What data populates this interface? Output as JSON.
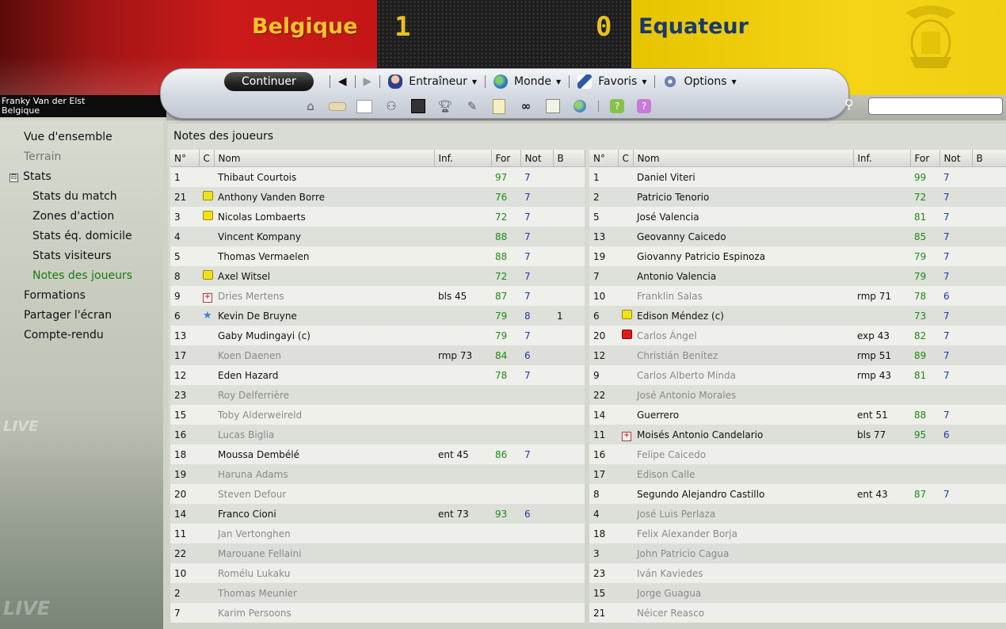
{
  "match": {
    "home_team": "Belgique",
    "away_team": "Equateur",
    "home_score": "1",
    "away_score": "0",
    "home_color": "#c41616",
    "away_color": "#f0cf12",
    "score_color": "#e8c21e"
  },
  "user": {
    "name": "Franky Van der Elst",
    "country": "Belgique"
  },
  "toolbar": {
    "continue_label": "Continuer",
    "menus": [
      {
        "label": "Entraîneur",
        "icon": "manager-icon"
      },
      {
        "label": "Monde",
        "icon": "globe-icon"
      },
      {
        "label": "Favoris",
        "icon": "pen-icon"
      },
      {
        "label": "Options",
        "icon": "gears-icon"
      }
    ],
    "quick_icons": [
      "home-icon",
      "inbox-icon",
      "calendar-icon",
      "squad-icon",
      "tactics-icon",
      "trophy-icon",
      "scout-icon",
      "notes-icon",
      "binoculars-icon",
      "document-icon",
      "world-icon",
      "help-icon",
      "question-icon"
    ]
  },
  "sidebar": {
    "items": [
      {
        "label": "Vue d'ensemble",
        "state": "normal"
      },
      {
        "label": "Terrain",
        "state": "disabled"
      },
      {
        "label": "Stats",
        "state": "expanded"
      },
      {
        "label": "Stats du match",
        "state": "child"
      },
      {
        "label": "Zones d'action",
        "state": "child"
      },
      {
        "label": "Stats éq. domicile",
        "state": "child"
      },
      {
        "label": "Stats visiteurs",
        "state": "child"
      },
      {
        "label": "Notes des joueurs",
        "state": "active"
      },
      {
        "label": "Formations",
        "state": "normal"
      },
      {
        "label": "Partager l'écran",
        "state": "normal"
      },
      {
        "label": "Compte-rendu",
        "state": "normal"
      }
    ],
    "tree_toggle": "⊟"
  },
  "content": {
    "title": "Notes des joueurs",
    "columns": [
      "N°",
      "C",
      "Nom",
      "Inf.",
      "For",
      "Not",
      "B"
    ],
    "home_players": [
      {
        "num": "1",
        "mark": "",
        "name": "Thibaut Courtois",
        "inf": "",
        "for": "97",
        "not": "7",
        "b": "",
        "subbed": false
      },
      {
        "num": "21",
        "mark": "yellow",
        "name": "Anthony Vanden Borre",
        "inf": "",
        "for": "76",
        "not": "7",
        "b": "",
        "subbed": false
      },
      {
        "num": "3",
        "mark": "yellow",
        "name": "Nicolas Lombaerts",
        "inf": "",
        "for": "72",
        "not": "7",
        "b": "",
        "subbed": false
      },
      {
        "num": "4",
        "mark": "",
        "name": "Vincent Kompany",
        "inf": "",
        "for": "88",
        "not": "7",
        "b": "",
        "subbed": false
      },
      {
        "num": "5",
        "mark": "",
        "name": "Thomas Vermaelen",
        "inf": "",
        "for": "88",
        "not": "7",
        "b": "",
        "subbed": false
      },
      {
        "num": "8",
        "mark": "yellow",
        "name": "Axel Witsel",
        "inf": "",
        "for": "72",
        "not": "7",
        "b": "",
        "subbed": false
      },
      {
        "num": "9",
        "mark": "injury",
        "name": "Dries Mertens",
        "inf": "bls 45",
        "for": "87",
        "not": "7",
        "b": "",
        "subbed": true
      },
      {
        "num": "6",
        "mark": "star",
        "name": "Kevin De Bruyne",
        "inf": "",
        "for": "79",
        "not": "8",
        "b": "1",
        "subbed": false
      },
      {
        "num": "13",
        "mark": "",
        "name": "Gaby Mudingayi (c)",
        "inf": "",
        "for": "79",
        "not": "7",
        "b": "",
        "subbed": false
      },
      {
        "num": "17",
        "mark": "",
        "name": "Koen Daenen",
        "inf": "rmp 73",
        "for": "84",
        "not": "6",
        "b": "",
        "subbed": true
      },
      {
        "num": "12",
        "mark": "",
        "name": "Eden Hazard",
        "inf": "",
        "for": "78",
        "not": "7",
        "b": "",
        "subbed": false
      },
      {
        "num": "23",
        "mark": "",
        "name": "Roy Delferrière",
        "inf": "",
        "for": "",
        "not": "",
        "b": "",
        "subbed": true
      },
      {
        "num": "15",
        "mark": "",
        "name": "Toby Alderweireld",
        "inf": "",
        "for": "",
        "not": "",
        "b": "",
        "subbed": true
      },
      {
        "num": "16",
        "mark": "",
        "name": "Lucas Biglia",
        "inf": "",
        "for": "",
        "not": "",
        "b": "",
        "subbed": true
      },
      {
        "num": "18",
        "mark": "",
        "name": "Moussa Dembélé",
        "inf": "ent 45",
        "for": "86",
        "not": "7",
        "b": "",
        "subbed": false
      },
      {
        "num": "19",
        "mark": "",
        "name": "Haruna Adams",
        "inf": "",
        "for": "",
        "not": "",
        "b": "",
        "subbed": true
      },
      {
        "num": "20",
        "mark": "",
        "name": "Steven Defour",
        "inf": "",
        "for": "",
        "not": "",
        "b": "",
        "subbed": true
      },
      {
        "num": "14",
        "mark": "",
        "name": "Franco Cioni",
        "inf": "ent 73",
        "for": "93",
        "not": "6",
        "b": "",
        "subbed": false
      },
      {
        "num": "11",
        "mark": "",
        "name": "Jan Vertonghen",
        "inf": "",
        "for": "",
        "not": "",
        "b": "",
        "subbed": true
      },
      {
        "num": "22",
        "mark": "",
        "name": "Marouane Fellaini",
        "inf": "",
        "for": "",
        "not": "",
        "b": "",
        "subbed": true
      },
      {
        "num": "10",
        "mark": "",
        "name": "Romélu Lukaku",
        "inf": "",
        "for": "",
        "not": "",
        "b": "",
        "subbed": true
      },
      {
        "num": "2",
        "mark": "",
        "name": "Thomas Meunier",
        "inf": "",
        "for": "",
        "not": "",
        "b": "",
        "subbed": true
      },
      {
        "num": "7",
        "mark": "",
        "name": "Karim Persoons",
        "inf": "",
        "for": "",
        "not": "",
        "b": "",
        "subbed": true
      }
    ],
    "away_players": [
      {
        "num": "1",
        "mark": "",
        "name": "Daniel Viteri",
        "inf": "",
        "for": "99",
        "not": "7",
        "b": "",
        "subbed": false
      },
      {
        "num": "2",
        "mark": "",
        "name": "Patricio Tenorio",
        "inf": "",
        "for": "72",
        "not": "7",
        "b": "",
        "subbed": false
      },
      {
        "num": "5",
        "mark": "",
        "name": "José Valencia",
        "inf": "",
        "for": "81",
        "not": "7",
        "b": "",
        "subbed": false
      },
      {
        "num": "13",
        "mark": "",
        "name": "Geovanny Caicedo",
        "inf": "",
        "for": "85",
        "not": "7",
        "b": "",
        "subbed": false
      },
      {
        "num": "19",
        "mark": "",
        "name": "Giovanny Patricio Espinoza",
        "inf": "",
        "for": "79",
        "not": "7",
        "b": "",
        "subbed": false
      },
      {
        "num": "7",
        "mark": "",
        "name": "Antonio Valencia",
        "inf": "",
        "for": "79",
        "not": "7",
        "b": "",
        "subbed": false
      },
      {
        "num": "10",
        "mark": "",
        "name": "Franklin Salas",
        "inf": "rmp 71",
        "for": "78",
        "not": "6",
        "b": "",
        "subbed": true
      },
      {
        "num": "6",
        "mark": "yellow",
        "name": "Edison Méndez (c)",
        "inf": "",
        "for": "73",
        "not": "7",
        "b": "",
        "subbed": false
      },
      {
        "num": "20",
        "mark": "red",
        "name": "Carlos Ángel",
        "inf": "exp 43",
        "for": "82",
        "not": "7",
        "b": "",
        "subbed": true
      },
      {
        "num": "12",
        "mark": "",
        "name": "Christián Benítez",
        "inf": "rmp 51",
        "for": "89",
        "not": "7",
        "b": "",
        "subbed": true
      },
      {
        "num": "9",
        "mark": "",
        "name": "Carlos Alberto Minda",
        "inf": "rmp 43",
        "for": "81",
        "not": "7",
        "b": "",
        "subbed": true
      },
      {
        "num": "22",
        "mark": "",
        "name": "José Antonio Morales",
        "inf": "",
        "for": "",
        "not": "",
        "b": "",
        "subbed": true
      },
      {
        "num": "14",
        "mark": "",
        "name": "Guerrero",
        "inf": "ent 51",
        "for": "88",
        "not": "7",
        "b": "",
        "subbed": false
      },
      {
        "num": "11",
        "mark": "injury",
        "name": "Moisés Antonio Candelario",
        "inf": "bls 77",
        "for": "95",
        "not": "6",
        "b": "",
        "subbed": false
      },
      {
        "num": "16",
        "mark": "",
        "name": "Felipe Caicedo",
        "inf": "",
        "for": "",
        "not": "",
        "b": "",
        "subbed": true
      },
      {
        "num": "17",
        "mark": "",
        "name": "Edison Calle",
        "inf": "",
        "for": "",
        "not": "",
        "b": "",
        "subbed": true
      },
      {
        "num": "8",
        "mark": "",
        "name": "Segundo Alejandro Castillo",
        "inf": "ent 43",
        "for": "87",
        "not": "7",
        "b": "",
        "subbed": false
      },
      {
        "num": "4",
        "mark": "",
        "name": "José Luis Perlaza",
        "inf": "",
        "for": "",
        "not": "",
        "b": "",
        "subbed": true
      },
      {
        "num": "18",
        "mark": "",
        "name": "Felix Alexander Borja",
        "inf": "",
        "for": "",
        "not": "",
        "b": "",
        "subbed": true
      },
      {
        "num": "3",
        "mark": "",
        "name": "John Patricio Cagua",
        "inf": "",
        "for": "",
        "not": "",
        "b": "",
        "subbed": true
      },
      {
        "num": "23",
        "mark": "",
        "name": "Iván Kaviedes",
        "inf": "",
        "for": "",
        "not": "",
        "b": "",
        "subbed": true
      },
      {
        "num": "15",
        "mark": "",
        "name": "Jorge Guagua",
        "inf": "",
        "for": "",
        "not": "",
        "b": "",
        "subbed": true
      },
      {
        "num": "21",
        "mark": "",
        "name": "Néicer Reasco",
        "inf": "",
        "for": "",
        "not": "",
        "b": "",
        "subbed": true
      }
    ]
  }
}
